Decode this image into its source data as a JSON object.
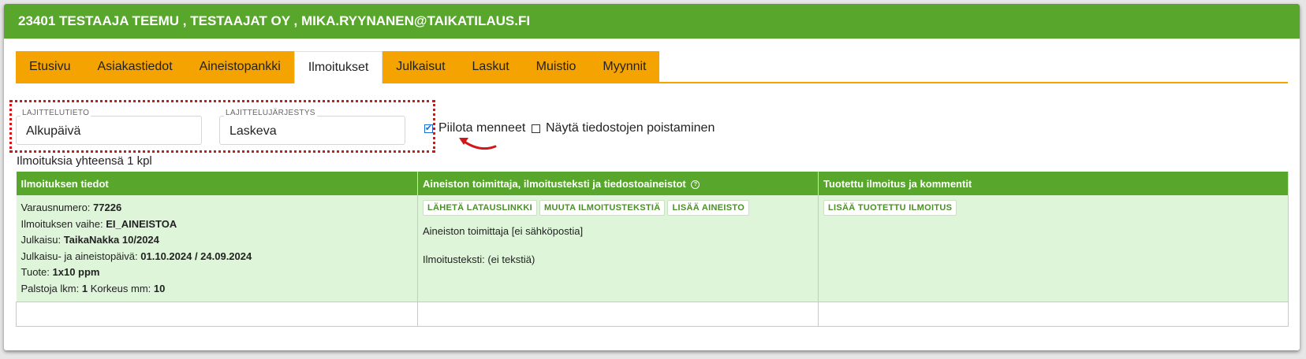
{
  "header": {
    "title": "23401 TESTAAJA TEEMU , TESTAAJAT OY , MIKA.RYYNANEN@TAIKATILAUS.FI"
  },
  "tabs": [
    {
      "label": "Etusivu"
    },
    {
      "label": "Asiakastiedot"
    },
    {
      "label": "Aineistopankki"
    },
    {
      "label": "Ilmoitukset"
    },
    {
      "label": "Julkaisut"
    },
    {
      "label": "Laskut"
    },
    {
      "label": "Muistio"
    },
    {
      "label": "Myynnit"
    }
  ],
  "active_tab": "Ilmoitukset",
  "sort": {
    "field_label": "LAJITTELUTIETO",
    "field_value": "Alkupäivä",
    "order_label": "LAJITTELUJÄRJESTYS",
    "order_value": "Laskeva"
  },
  "filters": {
    "hide_past_label": "Piilota menneet",
    "hide_past_checked": true,
    "show_deletions_label": "Näytä tiedostojen poistaminen",
    "show_deletions_checked": false
  },
  "count_text": "Ilmoituksia yhteensä 1 kpl",
  "table": {
    "headers": [
      "Ilmoituksen tiedot",
      "Aineiston toimittaja, ilmoitusteksti ja tiedostoaineistot",
      "Tuotettu ilmoitus ja kommentit"
    ],
    "help_icon": "?",
    "row": {
      "info": [
        {
          "label": "Varausnumero:",
          "value": "77226"
        },
        {
          "label": "Ilmoituksen vaihe:",
          "value": "EI_AINEISTOA"
        },
        {
          "label": "Julkaisu:",
          "value": "TaikaNakka 10/2024"
        },
        {
          "label": "Julkaisu- ja aineistopäivä:",
          "value": "01.10.2024 / 24.09.2024"
        },
        {
          "label": "Tuote:",
          "value": "1x10 ppm"
        }
      ],
      "columns_label": "Palstoja lkm:",
      "columns_value": "1",
      "height_label": "Korkeus mm:",
      "height_value": "10",
      "material_buttons": [
        "LÄHETÄ LATAUSLINKKI",
        "MUUTA ILMOITUSTEKSTIÄ",
        "LISÄÄ AINEISTO"
      ],
      "supplier_text": "Aineiston toimittaja [ei sähköpostia]",
      "ad_text": "Ilmoitusteksti: (ei tekstiä)",
      "produced_button": "LISÄÄ TUOTETTU ILMOITUS"
    }
  },
  "colors": {
    "header_green": "#58a62c",
    "tab_orange": "#f5a300",
    "row_bg": "#def5da",
    "annotation_red": "#d01818"
  }
}
